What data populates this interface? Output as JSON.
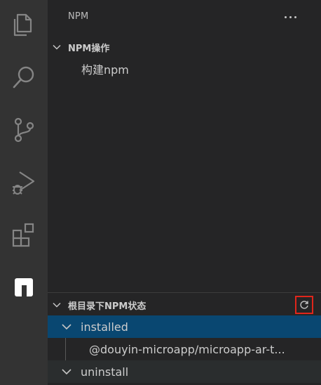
{
  "sidebar": {
    "title": "NPM",
    "more_label": "···",
    "sections": [
      {
        "title": "NPM操作",
        "items": [
          {
            "label": "构建npm"
          }
        ]
      },
      {
        "title": "根目录下NPM状态",
        "groups": [
          {
            "label": "installed",
            "expanded": true,
            "items": [
              {
                "label": "@douyin-microapp/microapp-ar-t..."
              }
            ]
          },
          {
            "label": "uninstall",
            "expanded": true,
            "items": []
          }
        ]
      }
    ]
  },
  "activity_bar": {
    "icons": [
      "files-icon",
      "search-icon",
      "source-control-icon",
      "run-debug-icon",
      "extensions-icon",
      "npm-icon"
    ]
  },
  "colors": {
    "activity_bar_bg": "#333333",
    "sidebar_bg": "#252526",
    "selection_bg": "#094771",
    "highlight_border": "#e0261b"
  }
}
